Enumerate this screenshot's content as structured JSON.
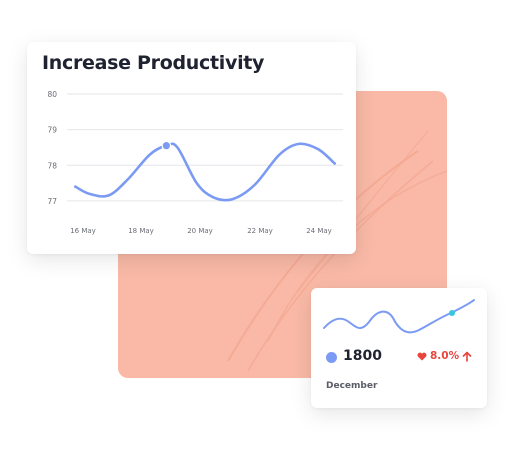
{
  "colors": {
    "line": "#7b9af3",
    "accent_card": "#f9b9a6",
    "marker_cyan": "#34c8e0",
    "positive_red": "#e8453c",
    "title": "#1f2230"
  },
  "productivity_card": {
    "title": "Increase Productivity"
  },
  "chart_data": {
    "type": "line",
    "title": "Increase Productivity",
    "x_ticks": [
      "16 May",
      "18 May",
      "20 May",
      "22 May",
      "24 May"
    ],
    "y_ticks": [
      "80",
      "79",
      "78",
      "77"
    ],
    "ylim": [
      76.9,
      80
    ],
    "grid": true,
    "series": [
      {
        "x": [
          15.3,
          15.8,
          16.5,
          17.2,
          18.0,
          18.6,
          19.0,
          19.7,
          20.3,
          21.0,
          21.8,
          22.7,
          23.4,
          24.1,
          24.7
        ],
        "y": [
          77.4,
          77.2,
          77.15,
          77.6,
          78.3,
          78.55,
          78.5,
          77.5,
          77.1,
          77.05,
          77.45,
          78.3,
          78.6,
          78.45,
          78.05
        ]
      }
    ],
    "highlight_point": {
      "x": 18.6,
      "y": 78.55
    }
  },
  "stat_card": {
    "value": "1800",
    "change": "8.0%",
    "period": "December",
    "change_icon": "heart-icon",
    "trend_icon": "arrow-up-icon"
  }
}
